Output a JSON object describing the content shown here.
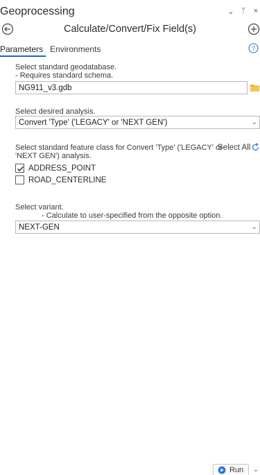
{
  "pane": {
    "title": "Geoprocessing",
    "controls": [
      "⌄",
      "ᛘ",
      "×"
    ]
  },
  "tool": {
    "title": "Calculate/Convert/Fix Field(s)"
  },
  "tabs": [
    {
      "label": "Parameters",
      "active": true
    },
    {
      "label": "Environments",
      "active": false
    }
  ],
  "params": {
    "gdb": {
      "label_line1": "Select standard geodatabase.",
      "label_line2": " - Requires standard schema.",
      "value": "NG911_v3.gdb"
    },
    "analysis": {
      "label": "Select desired analysis.",
      "value": "Convert 'Type' ('LEGACY' or 'NEXT GEN')"
    },
    "feature_class": {
      "label_line1": "Select standard feature class for Convert 'Type' ('LEGACY' or",
      "label_line2": "'NEXT GEN') analysis.",
      "select_all": "Select All",
      "options": [
        {
          "label": "ADDRESS_POINT",
          "checked": true
        },
        {
          "label": "ROAD_CENTERLINE",
          "checked": false
        }
      ]
    },
    "variant": {
      "label_line1": "Select variant.",
      "label_line2": "- Calculate to user-specified from the opposite option.",
      "value": "NEXT-GEN"
    }
  },
  "run": {
    "label": "Run"
  },
  "colors": {
    "accent": "#1a66c9",
    "folder": "#e8b33b"
  }
}
